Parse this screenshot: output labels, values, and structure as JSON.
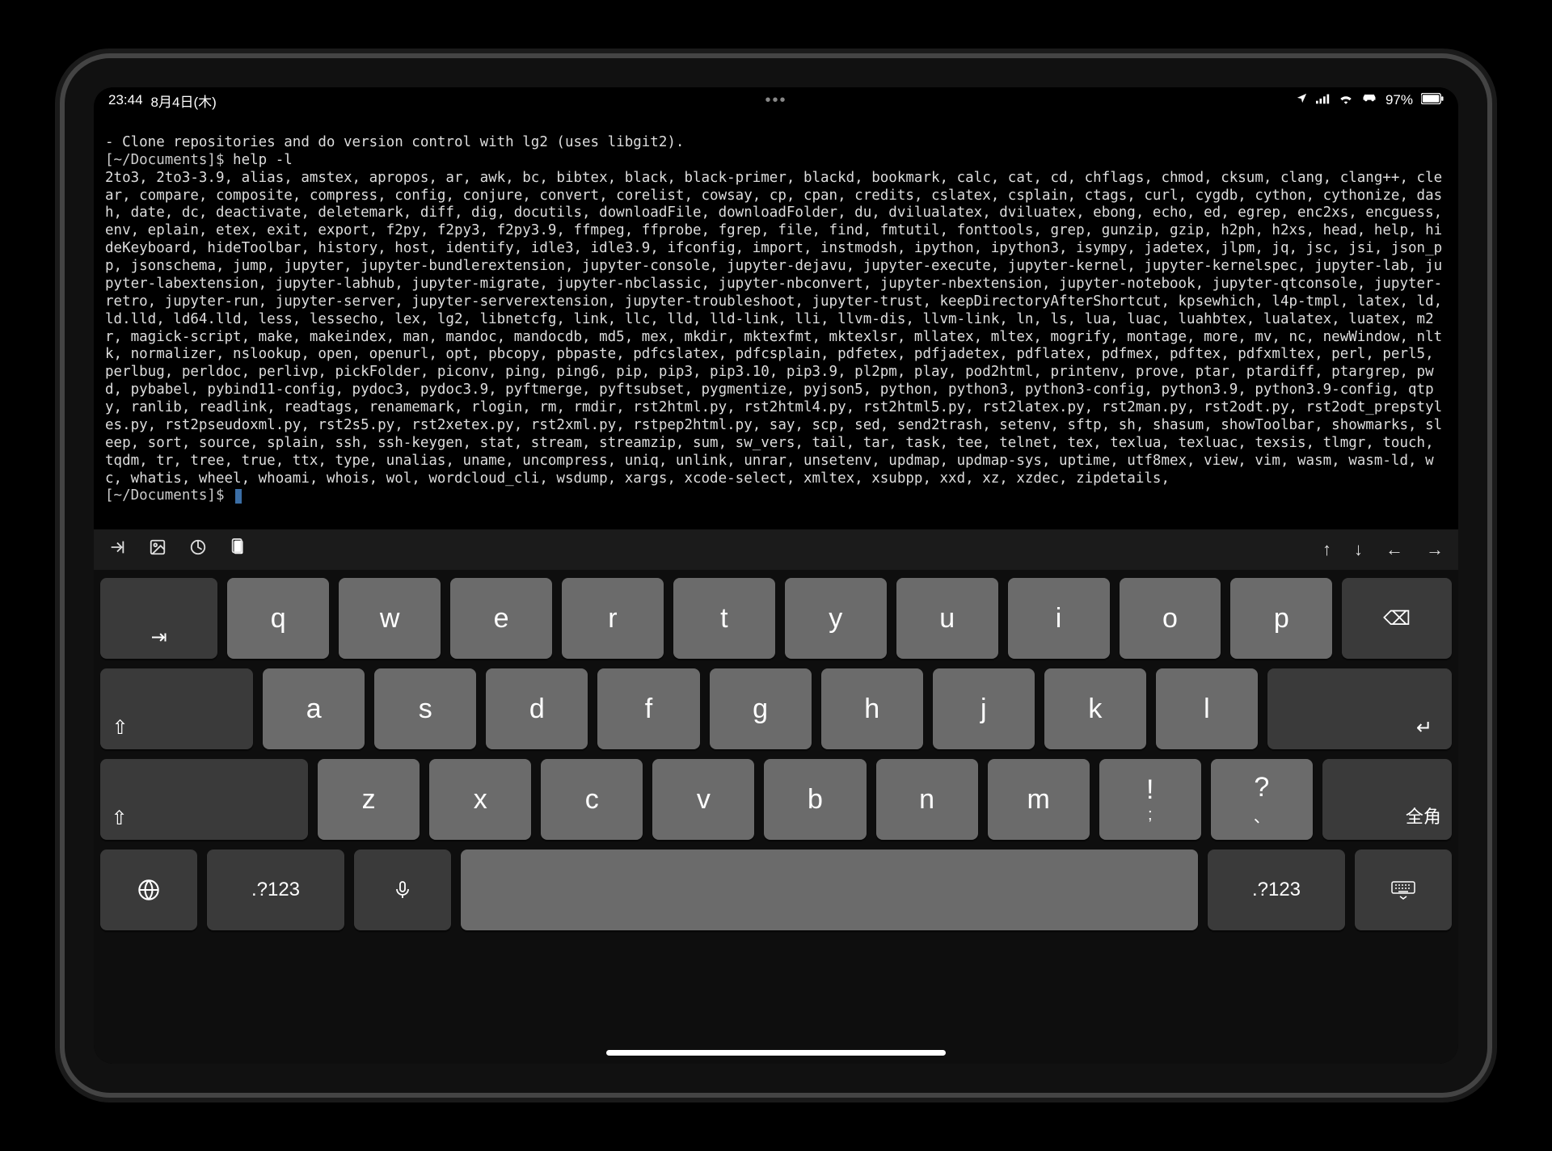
{
  "statusbar": {
    "time": "23:44",
    "date": "8月4日(木)",
    "battery": "97%",
    "icons": {
      "location": "➤",
      "signal": "ııl",
      "wifi": "✓",
      "car": "⊟"
    }
  },
  "terminal": {
    "intro": "- Clone repositories and do version control with lg2 (uses libgit2).",
    "prompt1": "[~/Documents]$ ",
    "cmd1": "help -l",
    "body": "2to3, 2to3-3.9, alias, amstex, apropos, ar, awk, bc, bibtex, black, black-primer, blackd, bookmark, calc, cat, cd, chflags, chmod, cksum, clang, clang++, clear, compare, composite, compress, config, conjure, convert, corelist, cowsay, cp, cpan, credits, cslatex, csplain, ctags, curl, cygdb, cython, cythonize, dash, date, dc, deactivate, deletemark, diff, dig, docutils, downloadFile, downloadFolder, du, dvilualatex, dviluatex, ebong, echo, ed, egrep, enc2xs, encguess, env, eplain, etex, exit, export, f2py, f2py3, f2py3.9, ffmpeg, ffprobe, fgrep, file, find, fmtutil, fonttools, grep, gunzip, gzip, h2ph, h2xs, head, help, hideKeyboard, hideToolbar, history, host, identify, idle3, idle3.9, ifconfig, import, instmodsh, ipython, ipython3, isympy, jadetex, jlpm, jq, jsc, jsi, json_pp, jsonschema, jump, jupyter, jupyter-bundlerextension, jupyter-console, jupyter-dejavu, jupyter-execute, jupyter-kernel, jupyter-kernelspec, jupyter-lab, jupyter-labextension, jupyter-labhub, jupyter-migrate, jupyter-nbclassic, jupyter-nbconvert, jupyter-nbextension, jupyter-notebook, jupyter-qtconsole, jupyter-retro, jupyter-run, jupyter-server, jupyter-serverextension, jupyter-troubleshoot, jupyter-trust, keepDirectoryAfterShortcut, kpsewhich, l4p-tmpl, latex, ld, ld.lld, ld64.lld, less, lessecho, lex, lg2, libnetcfg, link, llc, lld, lld-link, lli, llvm-dis, llvm-link, ln, ls, lua, luac, luahbtex, lualatex, luatex, m2r, magick-script, make, makeindex, man, mandoc, mandocdb, md5, mex, mkdir, mktexfmt, mktexlsr, mllatex, mltex, mogrify, montage, more, mv, nc, newWindow, nltk, normalizer, nslookup, open, openurl, opt, pbcopy, pbpaste, pdfcslatex, pdfcsplain, pdfetex, pdfjadetex, pdflatex, pdfmex, pdftex, pdfxmltex, perl, perl5, perlbug, perldoc, perlivp, pickFolder, piconv, ping, ping6, pip, pip3, pip3.10, pip3.9, pl2pm, play, pod2html, printenv, prove, ptar, ptardiff, ptargrep, pwd, pybabel, pybind11-config, pydoc3, pydoc3.9, pyftmerge, pyftsubset, pygmentize, pyjson5, python, python3, python3-config, python3.9, python3.9-config, qtpy, ranlib, readlink, readtags, renamemark, rlogin, rm, rmdir, rst2html.py, rst2html4.py, rst2html5.py, rst2latex.py, rst2man.py, rst2odt.py, rst2odt_prepstyles.py, rst2pseudoxml.py, rst2s5.py, rst2xetex.py, rst2xml.py, rstpep2html.py, say, scp, sed, send2trash, setenv, sftp, sh, shasum, showToolbar, showmarks, sleep, sort, source, splain, ssh, ssh-keygen, stat, stream, streamzip, sum, sw_vers, tail, tar, task, tee, telnet, tex, texlua, texluac, texsis, tlmgr, touch, tqdm, tr, tree, true, ttx, type, unalias, uname, uncompress, uniq, unlink, unrar, unsetenv, updmap, updmap-sys, uptime, utf8mex, view, vim, wasm, wasm-ld, wc, whatis, wheel, whoami, whois, wol, wordcloud_cli, wsdump, xargs, xcode-select, xmltex, xsubpp, xxd, xz, xzdec, zipdetails,",
    "prompt2": "[~/Documents]$ "
  },
  "accessory": {
    "left": [
      "tab-right-icon",
      "photo-icon",
      "timer-icon",
      "paste-icon"
    ],
    "right": [
      "arrow-up-icon",
      "arrow-down-icon",
      "arrow-left-icon",
      "arrow-right-icon"
    ]
  },
  "keyboard": {
    "row1": [
      "q",
      "w",
      "e",
      "r",
      "t",
      "y",
      "u",
      "i",
      "o",
      "p"
    ],
    "row2": [
      "a",
      "s",
      "d",
      "f",
      "g",
      "h",
      "j",
      "k",
      "l"
    ],
    "row3": [
      "z",
      "x",
      "c",
      "v",
      "b",
      "n",
      "m",
      "!",
      "?"
    ],
    "row3_sub": [
      "",
      "",
      "",
      "",
      "",
      "",
      "",
      ";",
      "、"
    ],
    "tab": "⇥",
    "backspace": "⌫",
    "caps": "⇧",
    "enter": "↵",
    "shift": "⇧",
    "zenkaku": "全角",
    "globe": "🌐",
    "numbers": ".?123",
    "mic": "🎤",
    "dismiss": "⌨"
  }
}
